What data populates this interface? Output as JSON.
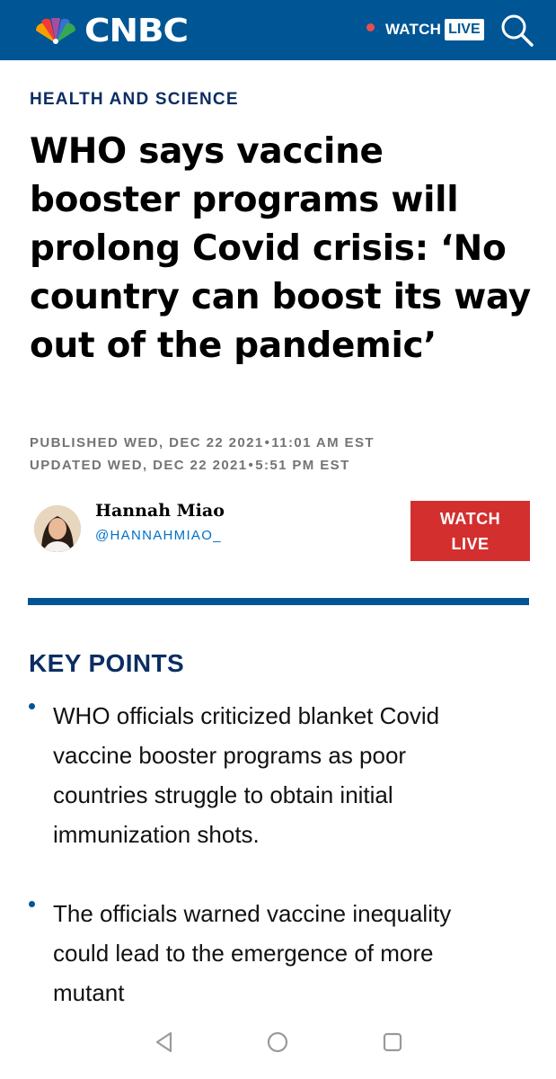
{
  "header": {
    "brand": "CNBC",
    "watch_label": "WATCH",
    "live_label": "LIVE",
    "colors": {
      "bar": "#005594",
      "live_dot": "#e84e4f"
    }
  },
  "article": {
    "section": "HEALTH AND SCIENCE",
    "headline": "WHO says vaccine booster programs will prolong Covid crisis: ‘No country can boost its way out of the pandemic’",
    "published": {
      "label": "PUBLISHED WED, DEC 22 2021",
      "time": "11:01 AM EST"
    },
    "updated": {
      "label": "UPDATED WED, DEC 22 2021",
      "time": "5:51 PM EST"
    },
    "author": {
      "name": "Hannah Miao",
      "handle": "@HANNAHMIAO_"
    },
    "watch_button": {
      "line1": "WATCH",
      "line2": "LIVE",
      "color": "#d32f2f"
    }
  },
  "key_points": {
    "title": "KEY POINTS",
    "items": [
      "WHO officials criticized blanket Covid vaccine booster programs as poor countries struggle to obtain initial immunization shots.",
      "The officials warned vaccine inequality could lead to the emergence of more mutant"
    ]
  },
  "navbar": {
    "icons": [
      "back-icon",
      "home-icon",
      "recents-icon"
    ]
  }
}
